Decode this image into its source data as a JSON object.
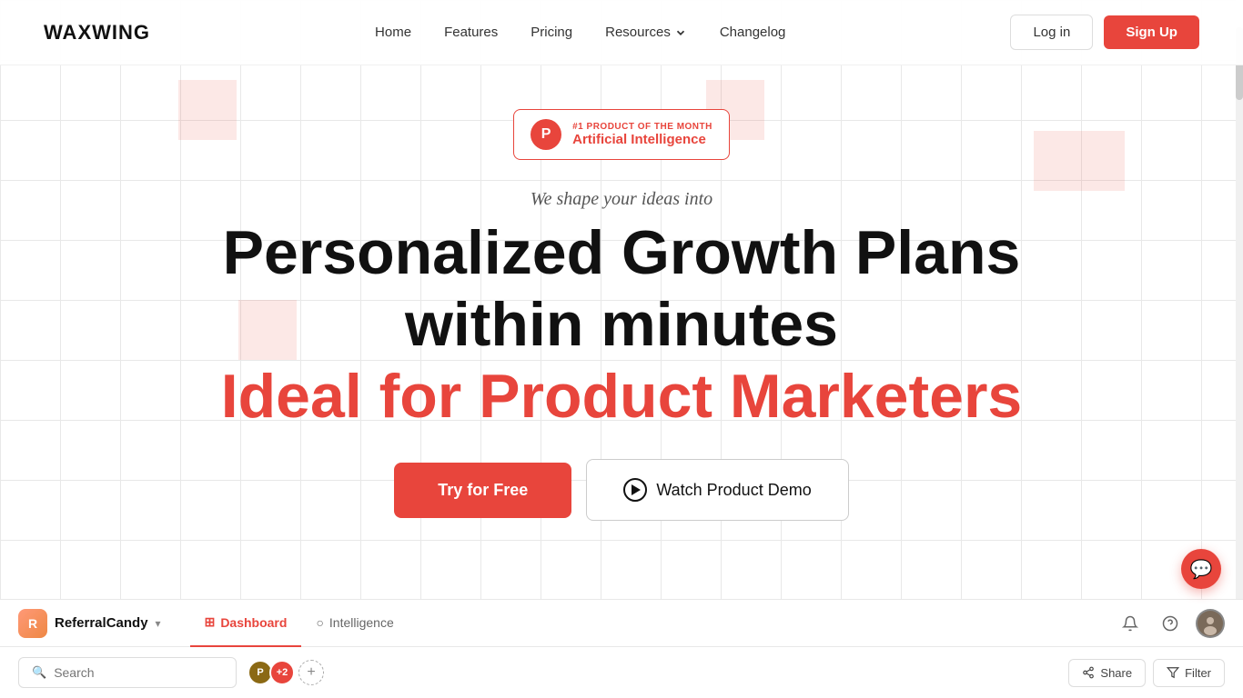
{
  "navbar": {
    "logo": "WAXWING",
    "links": [
      {
        "id": "home",
        "label": "Home",
        "active": true
      },
      {
        "id": "features",
        "label": "Features",
        "active": false
      },
      {
        "id": "pricing",
        "label": "Pricing",
        "active": false
      },
      {
        "id": "resources",
        "label": "Resources",
        "hasDropdown": true,
        "active": false
      },
      {
        "id": "changelog",
        "label": "Changelog",
        "active": false
      }
    ],
    "login_label": "Log in",
    "signup_label": "Sign Up"
  },
  "badge": {
    "icon_letter": "P",
    "label": "#1 PRODUCT OF THE MONTH",
    "title": "Artificial Intelligence"
  },
  "hero": {
    "subtitle": "We shape your ideas into",
    "headline_line1": "Personalized Growth Plans",
    "headline_line2": "within minutes",
    "headline_red": "Ideal for Product Marketers",
    "cta_try": "Try for Free",
    "cta_demo": "Watch Product Demo"
  },
  "app_bar": {
    "logo_letter": "R",
    "app_name": "ReferralCandy",
    "tabs": [
      {
        "id": "dashboard",
        "label": "Dashboard",
        "icon": "⊞",
        "active": true
      },
      {
        "id": "intelligence",
        "label": "Intelligence",
        "icon": "○",
        "active": false
      }
    ],
    "search_placeholder": "Search",
    "avatars": [
      {
        "letter": "P",
        "color": "#8B6914"
      }
    ],
    "badge_count": "+2",
    "share_label": "Share",
    "filter_label": "Filter"
  },
  "colors": {
    "brand_red": "#e8453c",
    "text_dark": "#111111",
    "text_mid": "#555555",
    "border": "#e8e8e8"
  }
}
